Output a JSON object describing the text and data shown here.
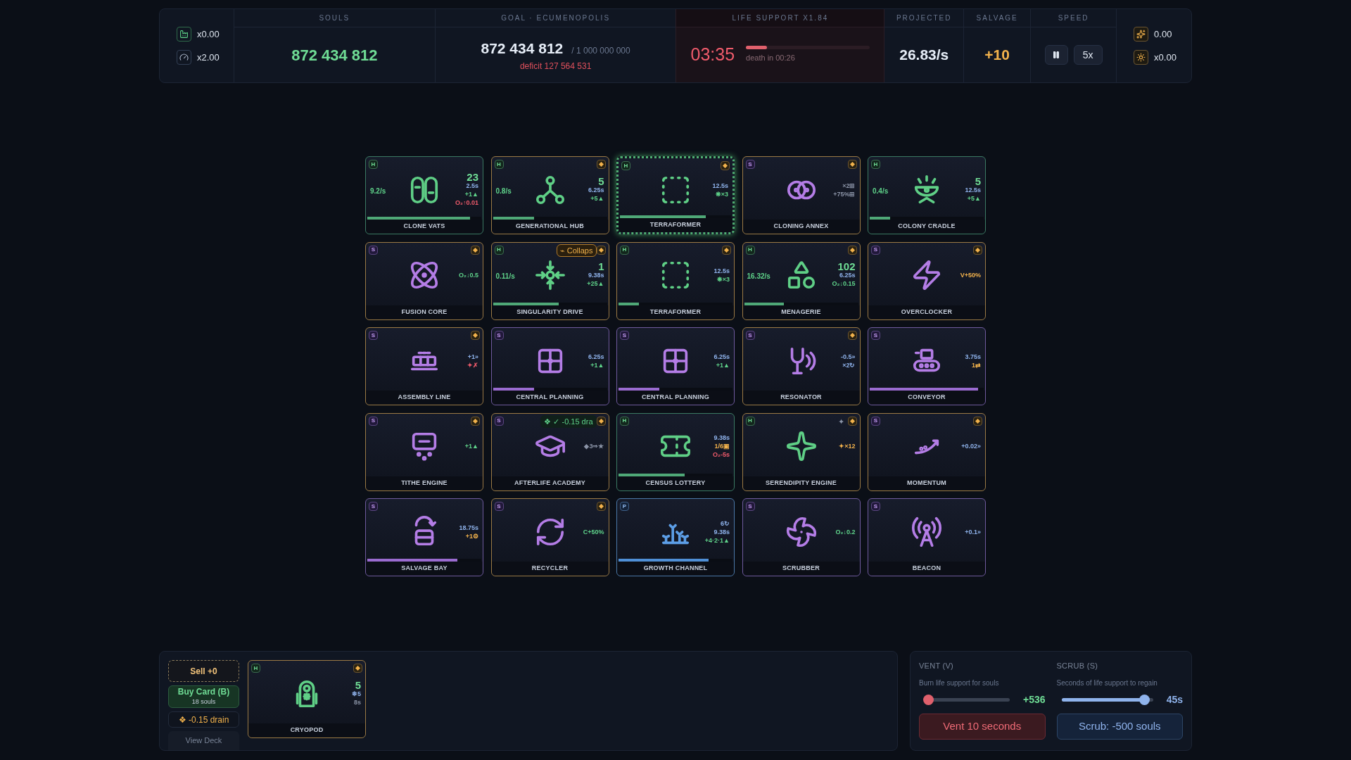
{
  "top_bar": {
    "left_stats": [
      {
        "value": "x0.00"
      },
      {
        "value": "x2.00"
      }
    ],
    "souls": {
      "label": "SOULS",
      "value": "872 434 812"
    },
    "goal": {
      "label": "GOAL · ECUMENOPOLIS",
      "value": "872 434 812",
      "target": "/ 1 000 000 000",
      "deficit": "deficit 127 564 531"
    },
    "life_support": {
      "label": "LIFE SUPPORT X1.84",
      "timer": "03:35",
      "level": 0.17,
      "note": "death in 00:26"
    },
    "projected": {
      "label": "PROJECTED",
      "value": "26.83/s"
    },
    "salvage": {
      "label": "SALVAGE",
      "value": "+10"
    },
    "speed": {
      "label": "SPEED",
      "rate": "5x"
    },
    "right_stats": [
      {
        "value": "0.00"
      },
      {
        "value": "x0.00"
      }
    ]
  },
  "board": [
    {
      "tag": "H",
      "name": "CLONE VATS",
      "marked": false,
      "highlighted": false,
      "rate": "9.2/s",
      "level": 0.9,
      "stats": [
        {
          "text": "23",
          "kind": "count"
        },
        {
          "text": "2.5s",
          "kind": "blue"
        },
        {
          "text": "+1▲",
          "kind": "green"
        },
        {
          "text": "O₂↑0.01",
          "kind": "red"
        }
      ]
    },
    {
      "tag": "H",
      "name": "GENERATIONAL HUB",
      "marked": true,
      "highlighted": false,
      "rate": "0.8/s",
      "level": 0.36,
      "stats": [
        {
          "text": "5",
          "kind": "count"
        },
        {
          "text": "6.25s",
          "kind": "blue"
        },
        {
          "text": "+5▲",
          "kind": "green"
        }
      ]
    },
    {
      "tag": "H",
      "name": "TERRAFORMER",
      "marked": true,
      "highlighted": true,
      "level": 0.77,
      "stats": [
        {
          "text": "12.5s",
          "kind": "blue"
        },
        {
          "text": "❋×3",
          "kind": "green"
        }
      ]
    },
    {
      "tag": "S",
      "name": "CLONING ANNEX",
      "marked": true,
      "highlighted": false,
      "stats": [
        {
          "text": "×2⊞",
          "kind": "gray"
        },
        {
          "text": "+75%⊞",
          "kind": "gray"
        }
      ]
    },
    {
      "tag": "H",
      "name": "COLONY CRADLE",
      "marked": false,
      "highlighted": false,
      "rate": "0.4/s",
      "level": 0.18,
      "stats": [
        {
          "text": "5",
          "kind": "count"
        },
        {
          "text": "12.5s",
          "kind": "blue"
        },
        {
          "text": "+5▲",
          "kind": "green"
        }
      ]
    },
    {
      "tag": "S",
      "name": "FUSION CORE",
      "marked": true,
      "highlighted": false,
      "stats": [
        {
          "text": "O₂↓0.5",
          "kind": "green"
        }
      ]
    },
    {
      "tag": "H",
      "name": "SINGULARITY DRIVE",
      "marked": true,
      "highlighted": false,
      "rate": "0.11/s",
      "level": 0.58,
      "badge": {
        "text": "⌁ Collaps",
        "kind": "orange"
      },
      "stats": [
        {
          "text": "1",
          "kind": "count"
        },
        {
          "text": "9.38s",
          "kind": "blue"
        },
        {
          "text": "+25▲",
          "kind": "green"
        }
      ]
    },
    {
      "tag": "H",
      "name": "TERRAFORMER",
      "marked": true,
      "highlighted": false,
      "level": 0.18,
      "stats": [
        {
          "text": "12.5s",
          "kind": "blue"
        },
        {
          "text": "❋×3",
          "kind": "green"
        }
      ]
    },
    {
      "tag": "H",
      "name": "MENAGERIE",
      "marked": true,
      "highlighted": false,
      "rate": "16.32/s",
      "level": 0.35,
      "stats": [
        {
          "text": "102",
          "kind": "count"
        },
        {
          "text": "6.25s",
          "kind": "blue"
        },
        {
          "text": "O₂↓0.15",
          "kind": "green"
        }
      ]
    },
    {
      "tag": "S",
      "name": "OVERCLOCKER",
      "marked": true,
      "highlighted": false,
      "stats": [
        {
          "text": "V+50%",
          "kind": "orange"
        }
      ]
    },
    {
      "tag": "S",
      "name": "ASSEMBLY LINE",
      "marked": true,
      "highlighted": false,
      "stats": [
        {
          "text": "+1»",
          "kind": "blue"
        },
        {
          "text": "✦✗",
          "kind": "red"
        }
      ]
    },
    {
      "tag": "S",
      "name": "CENTRAL PLANNING",
      "marked": false,
      "highlighted": false,
      "level": 0.36,
      "stats": [
        {
          "text": "6.25s",
          "kind": "blue"
        },
        {
          "text": "+1▲",
          "kind": "green"
        }
      ]
    },
    {
      "tag": "S",
      "name": "CENTRAL PLANNING",
      "marked": false,
      "highlighted": false,
      "level": 0.36,
      "stats": [
        {
          "text": "6.25s",
          "kind": "blue"
        },
        {
          "text": "+1▲",
          "kind": "green"
        }
      ]
    },
    {
      "tag": "S",
      "name": "RESONATOR",
      "marked": true,
      "highlighted": false,
      "stats": [
        {
          "text": "-0.5»",
          "kind": "blue"
        },
        {
          "text": "×2↻",
          "kind": "blue"
        }
      ]
    },
    {
      "tag": "S",
      "name": "CONVEYOR",
      "marked": false,
      "highlighted": false,
      "level": 0.95,
      "stats": [
        {
          "text": "3.75s",
          "kind": "blue"
        },
        {
          "text": "1⇄",
          "kind": "orange"
        }
      ]
    },
    {
      "tag": "S",
      "name": "TITHE ENGINE",
      "marked": true,
      "highlighted": false,
      "stats": [
        {
          "text": "+1▲",
          "kind": "green"
        }
      ]
    },
    {
      "tag": "S",
      "name": "AFTERLIFE ACADEMY",
      "marked": true,
      "highlighted": false,
      "badge": {
        "text": "❖ ✓ -0.15 dra",
        "kind": "green"
      },
      "stats": [
        {
          "text": "◆3⇒★",
          "kind": "gray"
        }
      ]
    },
    {
      "tag": "H",
      "name": "CENSUS LOTTERY",
      "marked": false,
      "highlighted": false,
      "level": 0.58,
      "stats": [
        {
          "text": "9.38s",
          "kind": "blue"
        },
        {
          "text": "1/6▣",
          "kind": "orange"
        },
        {
          "text": "O₂-5s",
          "kind": "red"
        }
      ]
    },
    {
      "tag": "H",
      "name": "SERENDIPITY ENGINE",
      "marked": true,
      "highlighted": false,
      "badge": {
        "text": "✦",
        "kind": "plain"
      },
      "stats": [
        {
          "text": "✦×12",
          "kind": "orange"
        }
      ]
    },
    {
      "tag": "S",
      "name": "MOMENTUM",
      "marked": true,
      "highlighted": false,
      "stats": [
        {
          "text": "+0.02»",
          "kind": "blue"
        }
      ]
    },
    {
      "tag": "S",
      "name": "SALVAGE BAY",
      "marked": false,
      "highlighted": false,
      "level": 0.79,
      "stats": [
        {
          "text": "18.75s",
          "kind": "blue"
        },
        {
          "text": "+1⚙",
          "kind": "orange"
        }
      ]
    },
    {
      "tag": "S",
      "name": "RECYCLER",
      "marked": true,
      "highlighted": false,
      "stats": [
        {
          "text": "C+50%",
          "kind": "green"
        }
      ]
    },
    {
      "tag": "P",
      "name": "GROWTH CHANNEL",
      "marked": false,
      "highlighted": false,
      "level": 0.79,
      "stats": [
        {
          "text": "6↻",
          "kind": "blue"
        },
        {
          "text": "9.38s",
          "kind": "blue"
        },
        {
          "text": "+4·2·1▲",
          "kind": "green"
        }
      ]
    },
    {
      "tag": "S",
      "name": "SCRUBBER",
      "marked": false,
      "highlighted": false,
      "stats": [
        {
          "text": "O₂↓0.2",
          "kind": "green"
        }
      ]
    },
    {
      "tag": "S",
      "name": "BEACON",
      "marked": false,
      "highlighted": false,
      "stats": [
        {
          "text": "+0.1»",
          "kind": "blue"
        }
      ]
    }
  ],
  "hand_actions": {
    "sell": "Sell +0",
    "buy": "Buy Card (B)",
    "buy_cost": "18 souls",
    "drain": "❖ -0.15 drain",
    "deck": "View Deck"
  },
  "hand": [
    {
      "tag": "H",
      "name": "CRYOPOD",
      "marked": true,
      "highlighted": false,
      "stats": [
        {
          "text": "5",
          "kind": "count"
        },
        {
          "text": "❄5",
          "kind": "blue"
        },
        {
          "text": "8s",
          "kind": "gray"
        }
      ]
    }
  ],
  "vent": {
    "title": "VENT (V)",
    "hint": "Burn life support for souls",
    "level": 0.05,
    "reading": "+536",
    "button": "Vent 10 seconds"
  },
  "scrub": {
    "title": "SCRUB (S)",
    "hint": "Seconds of life support to regain",
    "level": 0.9,
    "reading": "45s",
    "button": "Scrub: -500 souls"
  }
}
